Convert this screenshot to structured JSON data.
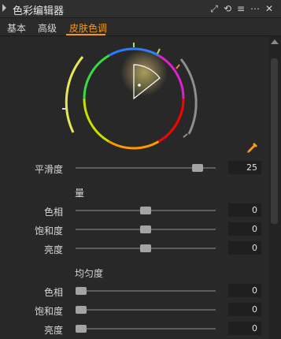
{
  "window": {
    "title": "色彩编辑器",
    "icons": [
      "expand-icon",
      "reset-icon",
      "menu-icon",
      "more-icon"
    ]
  },
  "tabs": [
    {
      "label": "基本",
      "active": false
    },
    {
      "label": "高级",
      "active": false
    },
    {
      "label": "皮肤色调",
      "active": true
    }
  ],
  "colors": {
    "accent": "#f59a1c",
    "background": "#2b2b2b"
  },
  "smoothness": {
    "label": "平滑度",
    "value": "25",
    "level": 0.9
  },
  "amount": {
    "title": "量",
    "hue": {
      "label": "色相",
      "value": "0",
      "level": 0.5
    },
    "saturation": {
      "label": "饱和度",
      "value": "0",
      "level": 0.5
    },
    "brightness": {
      "label": "亮度",
      "value": "0",
      "level": 0.5
    }
  },
  "uniformity": {
    "title": "均匀度",
    "hue": {
      "label": "色相",
      "value": "0",
      "level": 0.0
    },
    "saturation": {
      "label": "饱和度",
      "value": "0",
      "level": 0.0
    },
    "brightness": {
      "label": "亮度",
      "value": "0",
      "level": 0.0
    }
  }
}
